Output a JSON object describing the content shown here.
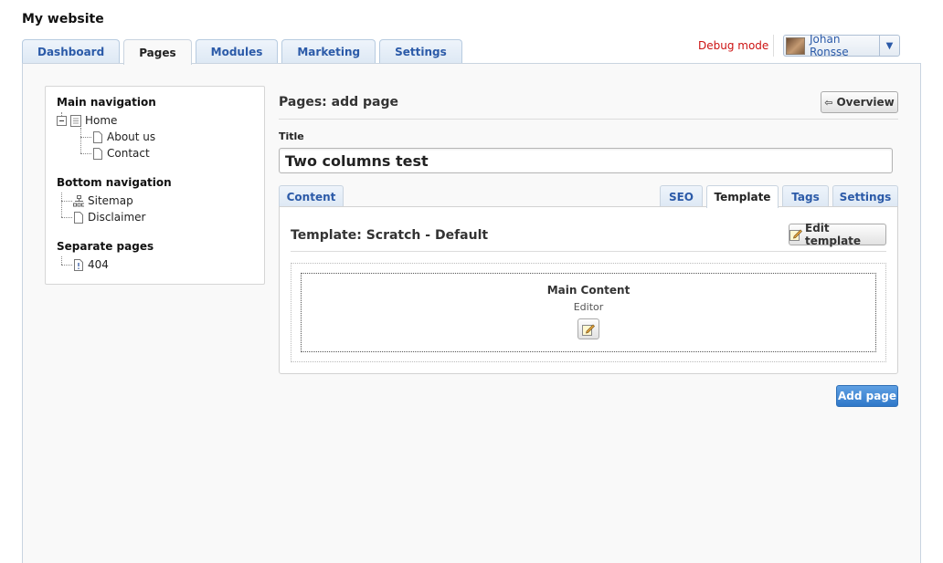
{
  "site": {
    "title": "My website"
  },
  "main_tabs": [
    {
      "label": "Dashboard",
      "active": false
    },
    {
      "label": "Pages",
      "active": true
    },
    {
      "label": "Modules",
      "active": false
    },
    {
      "label": "Marketing",
      "active": false
    },
    {
      "label": "Settings",
      "active": false
    }
  ],
  "header": {
    "debug_label": "Debug mode",
    "user": {
      "name": "Johan Ronsse",
      "menu_icon": "caret-down-icon"
    }
  },
  "sidebar": {
    "main_navigation": {
      "heading": "Main navigation",
      "items": [
        {
          "label": "Home",
          "icon": "page-list-icon"
        },
        {
          "label": "About us",
          "icon": "page-icon"
        },
        {
          "label": "Contact",
          "icon": "page-icon"
        }
      ]
    },
    "bottom_navigation": {
      "heading": "Bottom navigation",
      "items": [
        {
          "label": "Sitemap",
          "icon": "sitemap-icon"
        },
        {
          "label": "Disclaimer",
          "icon": "page-icon"
        }
      ]
    },
    "separate_pages": {
      "heading": "Separate pages",
      "items": [
        {
          "label": "404",
          "icon": "error-page-icon"
        }
      ]
    }
  },
  "main": {
    "heading": "Pages: add page",
    "overview_button": "Overview",
    "title_label": "Title",
    "title_value": "Two columns test",
    "content_tab": "Content",
    "right_tabs": [
      {
        "label": "SEO",
        "active": false
      },
      {
        "label": "Template",
        "active": true
      },
      {
        "label": "Tags",
        "active": false
      },
      {
        "label": "Settings",
        "active": false
      }
    ],
    "template_heading": "Template: Scratch - Default",
    "edit_template_button": "Edit template",
    "block": {
      "title": "Main Content",
      "subtitle": "Editor"
    },
    "add_page_button": "Add page"
  },
  "colors": {
    "link_blue": "#2b5aa8",
    "debug_red": "#cc1111",
    "primary": "#2f78c9"
  }
}
